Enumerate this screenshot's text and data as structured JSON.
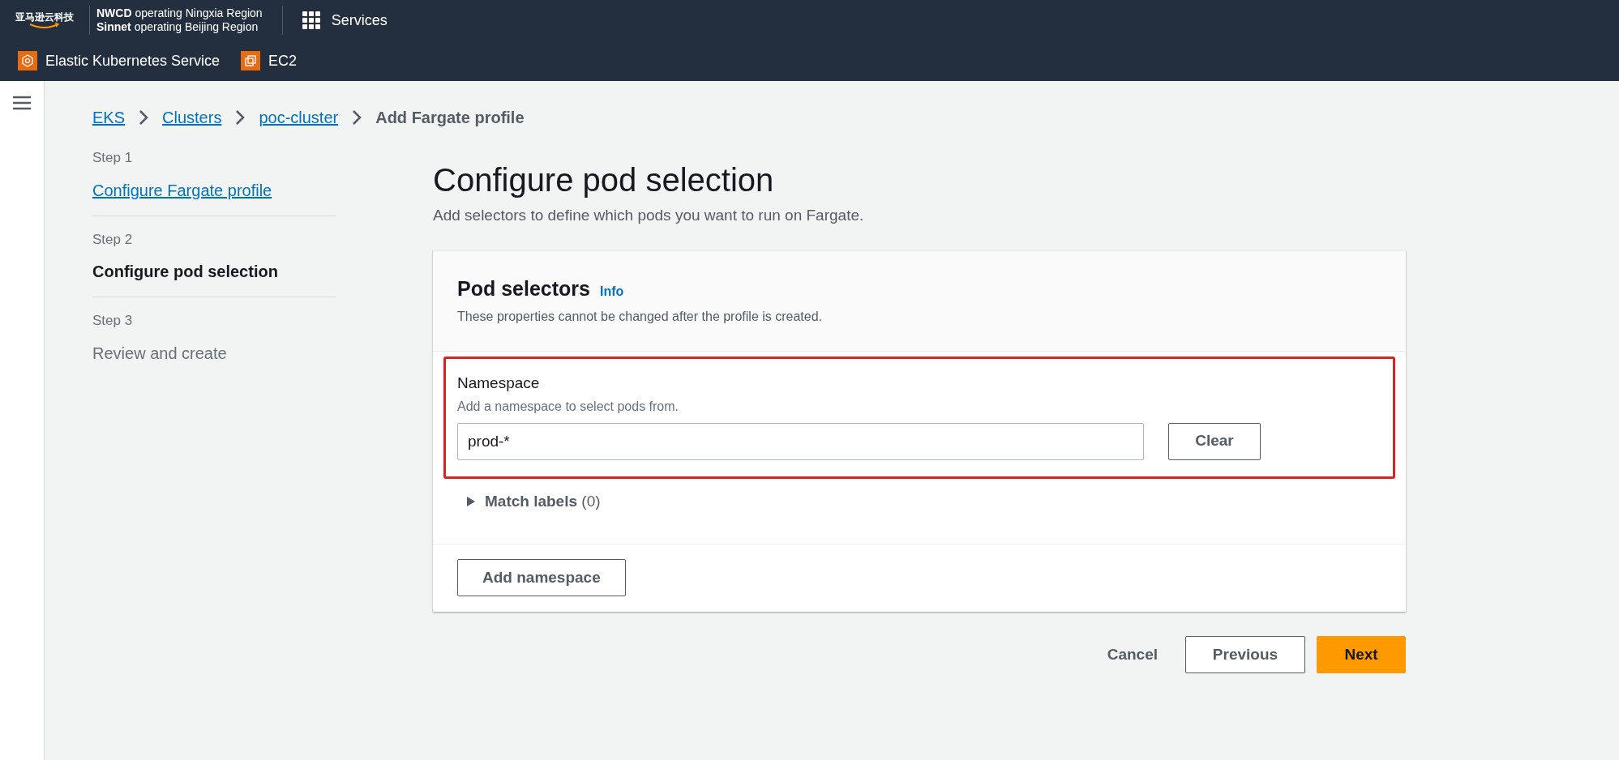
{
  "top_bar": {
    "logo": "亚马逊云科技",
    "regions": [
      {
        "bold": "NWCD",
        "rest": " operating Ningxia Region"
      },
      {
        "bold": "Sinnet",
        "rest": " operating Beijing Region"
      }
    ],
    "services": "Services"
  },
  "favorites": [
    {
      "label": "Elastic Kubernetes Service",
      "kind": "eks"
    },
    {
      "label": "EC2",
      "kind": "ec2"
    }
  ],
  "breadcrumbs": [
    {
      "label": "EKS",
      "current": false
    },
    {
      "label": "Clusters",
      "current": false
    },
    {
      "label": "poc-cluster",
      "current": false
    },
    {
      "label": "Add Fargate profile",
      "current": true
    }
  ],
  "steps": [
    {
      "step": "Step 1",
      "label": "Configure Fargate profile",
      "kind": "link"
    },
    {
      "step": "Step 2",
      "label": "Configure pod selection",
      "kind": "current"
    },
    {
      "step": "Step 3",
      "label": "Review and create",
      "kind": "disabled"
    }
  ],
  "page": {
    "title": "Configure pod selection",
    "description": "Add selectors to define which pods you want to run on Fargate."
  },
  "card": {
    "title": "Pod selectors",
    "info": "Info",
    "description": "These properties cannot be changed after the profile is created.",
    "namespace": {
      "label": "Namespace",
      "hint": "Add a namespace to select pods from.",
      "value": "prod-*",
      "clear": "Clear",
      "highlighted": true
    },
    "match_labels": {
      "label": "Match labels",
      "count": "(0)",
      "expanded": false
    },
    "add_button": "Add namespace"
  },
  "actions": [
    {
      "label": "Cancel",
      "kind": "link"
    },
    {
      "label": "Previous",
      "kind": "normal"
    },
    {
      "label": "Next",
      "kind": "primary"
    }
  ]
}
